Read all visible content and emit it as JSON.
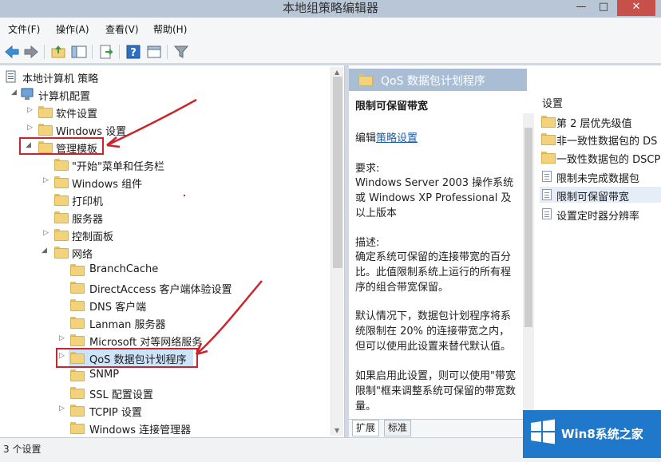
{
  "window": {
    "title": "本地组策略编辑器",
    "min_glyph": "—",
    "max_glyph": "□",
    "close_glyph": "✕"
  },
  "menu": [
    "文件(F)",
    "操作(A)",
    "查看(V)",
    "帮助(H)"
  ],
  "tree": {
    "root": "本地计算机 策略",
    "computer_config": "计算机配置",
    "software_settings": "软件设置",
    "windows_settings": "Windows 设置",
    "admin_templates": "管理模板",
    "start_menu": "\"开始\"菜单和任务栏",
    "windows_components": "Windows 组件",
    "printers": "打印机",
    "server": "服务器",
    "control_panel": "控制面板",
    "network": "网络",
    "branchcache": "BranchCache",
    "directaccess": "DirectAccess 客户端体验设置",
    "dns_client": "DNS 客户端",
    "lanman_server": "Lanman 服务器",
    "ms_p2p": "Microsoft 对等网络服务",
    "qos": "QoS 数据包计划程序",
    "snmp": "SNMP",
    "ssl": "SSL 配置设置",
    "tcpip": "TCPIP 设置",
    "windows_conn": "Windows 连接管理器"
  },
  "detail": {
    "header": "QoS 数据包计划程序",
    "setting_title": "限制可保留带宽",
    "edit_prefix": "编辑",
    "edit_link": "策略设置",
    "req_label": "要求:",
    "req_line1": "Windows Server 2003 操作系统",
    "req_line2": "或 Windows XP Professional 及",
    "req_line3": "以上版本",
    "desc_label": "描述:",
    "desc_line1": "确定系统可保留的连接带宽的百分",
    "desc_line2": "比。此值限制系统上运行的所有程",
    "desc_line3": "序的组合带宽保留。",
    "desc_line4": "默认情况下，数据包计划程序将系",
    "desc_line5": "统限制在 20% 的连接带宽之内，",
    "desc_line6": "但可以使用此设置来替代默认值。",
    "desc_line7": "如果启用此设置，则可以使用\"带宽",
    "desc_line8": "限制\"框来调整系统可保留的带宽数",
    "desc_line9": "量。"
  },
  "settings": {
    "column_header": "设置",
    "items": [
      {
        "label": "第 2 层优先级值",
        "icon": "folder-icon"
      },
      {
        "label": "非一致性数据包的 DS",
        "icon": "folder-icon"
      },
      {
        "label": "一致性数据包的 DSCP",
        "icon": "folder-icon"
      },
      {
        "label": "限制未完成数据包",
        "icon": "policy-icon"
      },
      {
        "label": "限制可保留带宽",
        "icon": "policy-icon"
      },
      {
        "label": "设置定时器分辨率",
        "icon": "policy-icon"
      }
    ]
  },
  "tabs": {
    "extended": "扩展",
    "standard": "标准"
  },
  "status": {
    "text": "3 个设置"
  },
  "watermark": {
    "text": "Win8系统之家"
  },
  "colors": {
    "annotation_red": "#c8262c",
    "header_blue": "#a9bed5",
    "watermark_blue": "#1f78c9"
  }
}
